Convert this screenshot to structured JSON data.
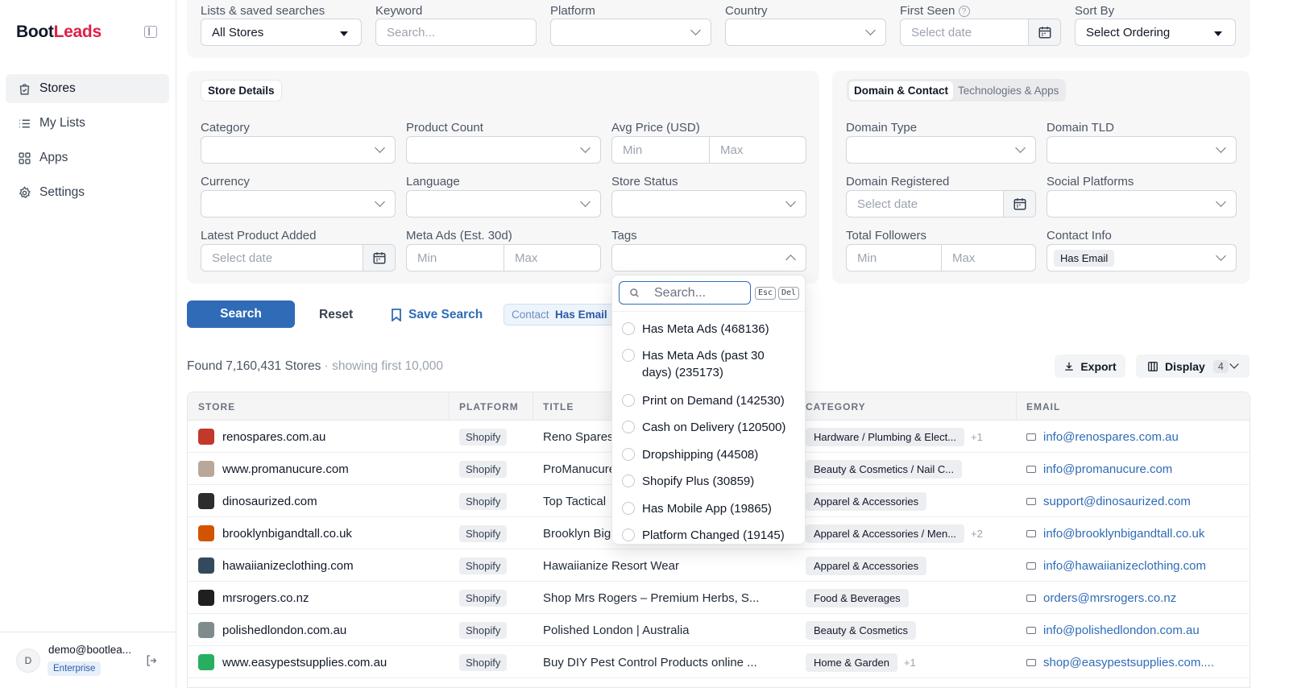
{
  "sidebar": {
    "logo_a": "Boot",
    "logo_b": "Leads",
    "items": [
      {
        "label": "Stores"
      },
      {
        "label": "My Lists"
      },
      {
        "label": "Apps"
      },
      {
        "label": "Settings"
      }
    ],
    "user": {
      "initial": "D",
      "email": "demo@bootlea...",
      "plan": "Enterprise"
    }
  },
  "topbar": {
    "lists": {
      "label": "Lists & saved searches",
      "value": "All Stores"
    },
    "keyword": {
      "label": "Keyword",
      "placeholder": "Search..."
    },
    "platform": {
      "label": "Platform"
    },
    "country": {
      "label": "Country"
    },
    "first_seen": {
      "label": "First Seen",
      "help": "?",
      "placeholder": "Select date"
    },
    "sort_by": {
      "label": "Sort By",
      "value": "Select Ordering"
    }
  },
  "store_details": {
    "title": "Store Details",
    "category": "Category",
    "product_count": "Product Count",
    "avg_price": "Avg Price (USD)",
    "min": "Min",
    "max": "Max",
    "currency": "Currency",
    "language": "Language",
    "store_status": "Store Status",
    "latest_product": "Latest Product Added",
    "date_placeholder": "Select date",
    "meta_ads": "Meta Ads (Est. 30d)",
    "tags": "Tags"
  },
  "domain_panel": {
    "tab_active": "Domain & Contact",
    "tab_other": "Technologies & Apps",
    "domain_type": "Domain Type",
    "domain_tld": "Domain TLD",
    "domain_registered": "Domain Registered",
    "date_placeholder": "Select date",
    "social_platforms": "Social Platforms",
    "total_followers": "Total Followers",
    "min": "Min",
    "max": "Max",
    "contact_info": "Contact Info",
    "contact_value": "Has Email"
  },
  "actions": {
    "search": "Search",
    "reset": "Reset",
    "save_search": "Save Search",
    "active_filter_key": "Contact",
    "active_filter_value": "Has Email"
  },
  "results": {
    "found": "Found 7,160,431 Stores",
    "showing": " · showing first 10,000",
    "export": "Export",
    "display": "Display",
    "display_count": "4"
  },
  "table": {
    "headers": [
      "STORE",
      "PLATFORM",
      "TITLE",
      "CATEGORY",
      "EMAIL"
    ],
    "rows": [
      {
        "store": "renospares.com.au",
        "platform": "Shopify",
        "title": "Reno Spares",
        "category": "Hardware / Plumbing & Elect...",
        "extra": "+1",
        "email": "info@renospares.com.au"
      },
      {
        "store": "www.promanucure.com",
        "platform": "Shopify",
        "title": "ProManucure",
        "category": "Beauty & Cosmetics / Nail C...",
        "extra": "",
        "email": "info@promanucure.com"
      },
      {
        "store": "dinosaurized.com",
        "platform": "Shopify",
        "title": "Top Tactical",
        "category": "Apparel & Accessories",
        "extra": "",
        "email": "support@dinosaurized.com"
      },
      {
        "store": "brooklynbigandtall.co.uk",
        "platform": "Shopify",
        "title": "Brooklyn Big",
        "category": "Apparel & Accessories / Men...",
        "extra": "+2",
        "email": "info@brooklynbigandtall.co.uk"
      },
      {
        "store": "hawaiianizeclothing.com",
        "platform": "Shopify",
        "title": "Hawaiianize Resort Wear",
        "category": "Apparel & Accessories",
        "extra": "",
        "email": "info@hawaiianizeclothing.com"
      },
      {
        "store": "mrsrogers.co.nz",
        "platform": "Shopify",
        "title": "Shop Mrs Rogers – Premium Herbs, S...",
        "category": "Food & Beverages",
        "extra": "",
        "email": "orders@mrsrogers.co.nz"
      },
      {
        "store": "polishedlondon.com.au",
        "platform": "Shopify",
        "title": "Polished London | Australia",
        "category": "Beauty & Cosmetics",
        "extra": "",
        "email": "info@polishedlondon.com.au"
      },
      {
        "store": "www.easypestsupplies.com.au",
        "platform": "Shopify",
        "title": "Buy DIY Pest Control Products online ...",
        "category": "Home & Garden",
        "extra": "+1",
        "email": "shop@easypestsupplies.com...."
      }
    ],
    "favicon_colors": [
      "#c0392b",
      "#b9a89a",
      "#2d2d2d",
      "#d35400",
      "#34495e",
      "#1f1f1f",
      "#7f8c8d",
      "#27ae60"
    ]
  },
  "tags_dropdown": {
    "search_placeholder": "Search...",
    "esc": "Esc",
    "del": "Del",
    "options": [
      "Has Meta Ads (468136)",
      "Has Meta Ads (past 30 days) (235173)",
      "Print on Demand (142530)",
      "Cash on Delivery (120500)",
      "Dropshipping (44508)",
      "Shopify Plus (30859)",
      "Has Mobile App (19865)",
      "Platform Changed (19145)"
    ]
  },
  "colors": {
    "brand": "#e11d48",
    "primary": "#2f6bb7"
  }
}
